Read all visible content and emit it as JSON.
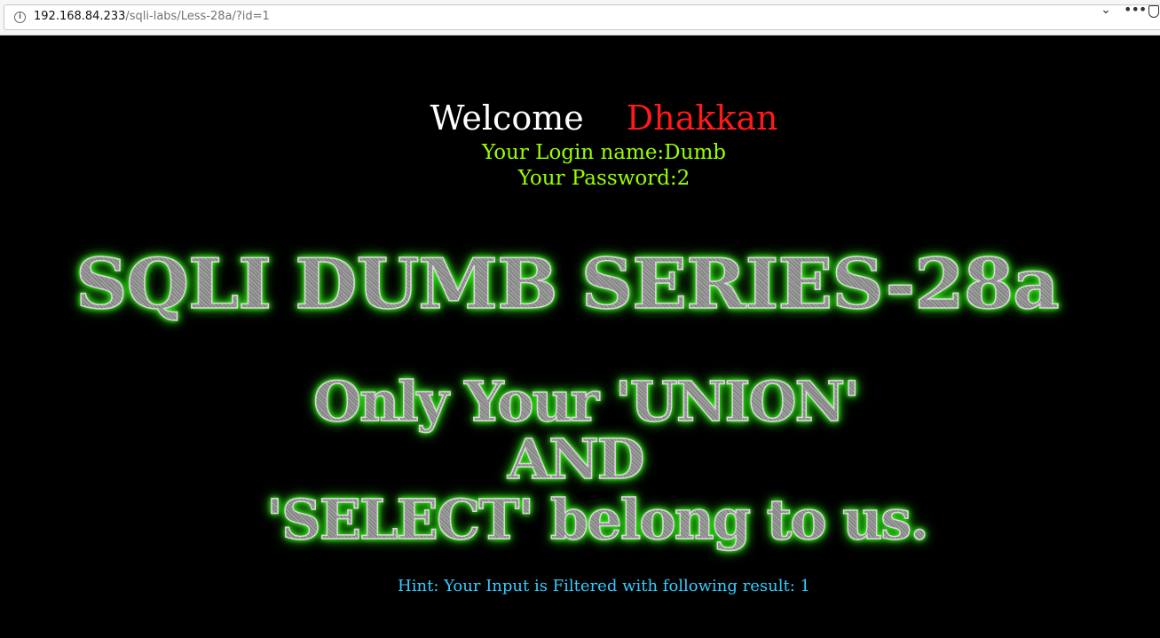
{
  "browser": {
    "url_host": "192.168.84.233",
    "url_path": "/sqli-labs/Less-28a/?id=1"
  },
  "page": {
    "welcome_label": "Welcome",
    "welcome_name": "Dhakkan",
    "login_line": "Your Login name:Dumb",
    "password_line": "Your Password:2",
    "banner_title": "SQLI DUMB SERIES-28a",
    "banner_line1": "Only Your 'UNION'",
    "banner_line2": "AND",
    "banner_line3": "'SELECT' belong to us.",
    "hint": "Hint: Your Input is Filtered with following result: 1"
  },
  "colors": {
    "background": "#000000",
    "welcome": "#ffffff",
    "name": "#ff1a1a",
    "info": "#99ff00",
    "hint": "#33ccff",
    "glow": "#39ff14"
  }
}
